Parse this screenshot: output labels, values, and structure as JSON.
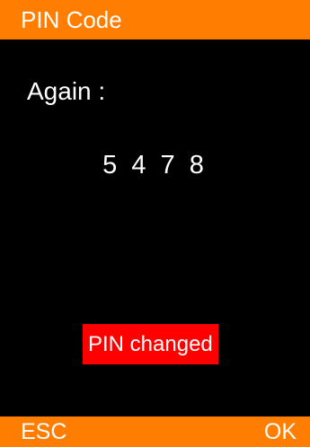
{
  "screen": {
    "title": "PIN Code",
    "prompt": "Again :",
    "pin_value": "5 4 7 8",
    "status_message": "PIN changed"
  },
  "softkeys": {
    "left": "ESC",
    "right": "OK"
  },
  "colors": {
    "background": "#000000",
    "accent": "#ff7d00",
    "status_background": "#ff0000",
    "text": "#ffffff"
  }
}
